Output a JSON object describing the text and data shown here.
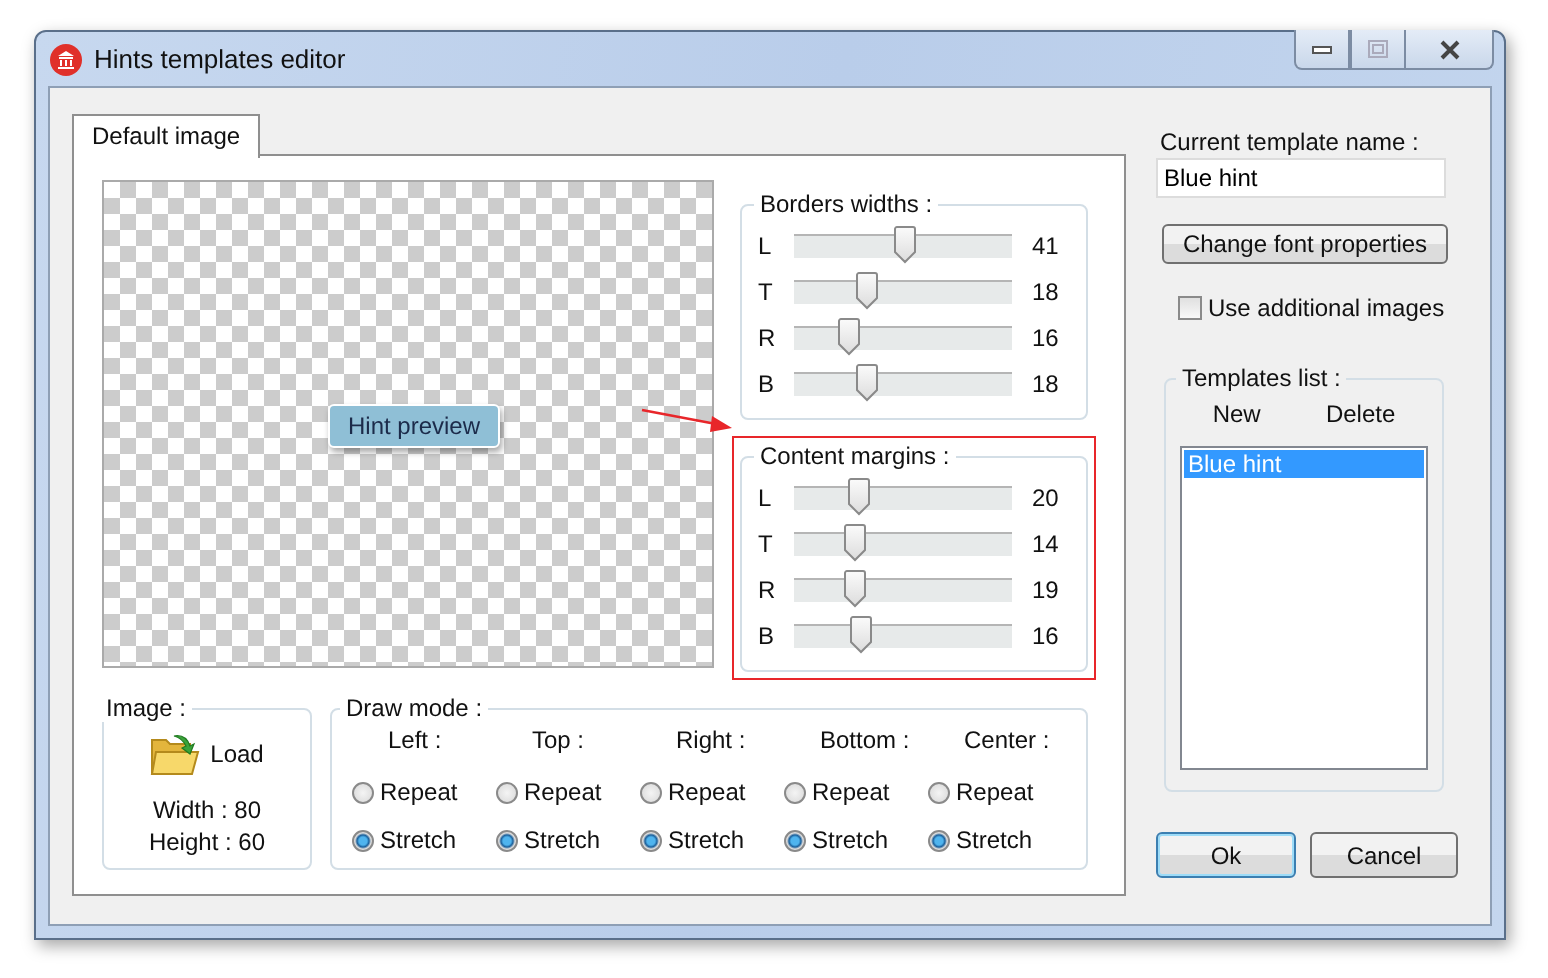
{
  "window": {
    "title": "Hints templates editor"
  },
  "tabs": [
    {
      "label": "Default image",
      "selected": true
    }
  ],
  "preview": {
    "hint": "Hint preview"
  },
  "borders_widths": {
    "title": "Borders widths :",
    "highlighted": false,
    "sliders": [
      {
        "label": "L",
        "level": 0.51,
        "reading": "41"
      },
      {
        "label": "T",
        "level": 0.32,
        "reading": "18"
      },
      {
        "label": "R",
        "level": 0.22,
        "reading": "16"
      },
      {
        "label": "B",
        "level": 0.32,
        "reading": "18"
      }
    ]
  },
  "content_margins": {
    "title": "Content margins :",
    "highlighted": true,
    "sliders": [
      {
        "label": "L",
        "level": 0.28,
        "reading": "20"
      },
      {
        "label": "T",
        "level": 0.25,
        "reading": "14"
      },
      {
        "label": "R",
        "level": 0.26,
        "reading": "19"
      },
      {
        "label": "B",
        "level": 0.29,
        "reading": "16"
      }
    ]
  },
  "image": {
    "title": "Image :",
    "load": "Load",
    "width": "Width : 80",
    "height": "Height : 60"
  },
  "draw_mode": {
    "title": "Draw mode :",
    "columns": [
      {
        "label": "Left :",
        "options": [
          {
            "label": "Repeat",
            "selected": false
          },
          {
            "label": "Stretch",
            "selected": true
          }
        ]
      },
      {
        "label": "Top :",
        "options": [
          {
            "label": "Repeat",
            "selected": false
          },
          {
            "label": "Stretch",
            "selected": true
          }
        ]
      },
      {
        "label": "Right :",
        "options": [
          {
            "label": "Repeat",
            "selected": false
          },
          {
            "label": "Stretch",
            "selected": true
          }
        ]
      },
      {
        "label": "Bottom :",
        "options": [
          {
            "label": "Repeat",
            "selected": false
          },
          {
            "label": "Stretch",
            "selected": true
          }
        ]
      },
      {
        "label": "Center :",
        "options": [
          {
            "label": "Repeat",
            "selected": false
          },
          {
            "label": "Stretch",
            "selected": true
          }
        ]
      }
    ]
  },
  "current_template_name": {
    "label": "Current template name :",
    "value": "Blue hint"
  },
  "change_font_button": "Change font properties",
  "use_additional_images": {
    "label": "Use additional images",
    "checked": false
  },
  "templates_list": {
    "title": "Templates list :",
    "actions": [
      "New",
      "Delete"
    ],
    "items": [
      {
        "label": "Blue hint",
        "selected": true
      }
    ]
  },
  "buttons": [
    {
      "label": "Ok",
      "default": true
    },
    {
      "label": "Cancel",
      "default": false
    }
  ]
}
